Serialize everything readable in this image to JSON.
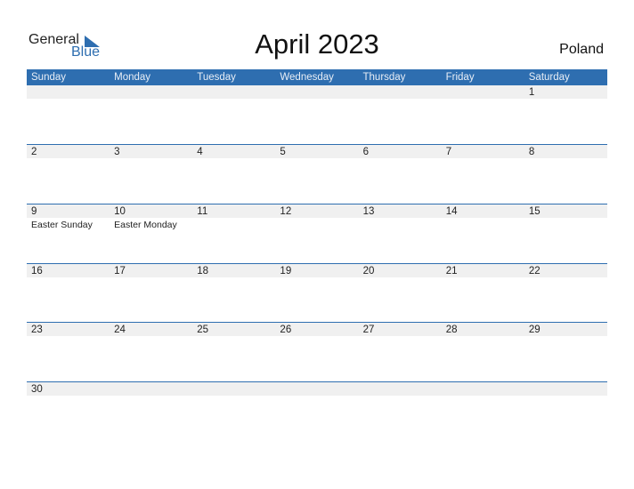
{
  "logo": {
    "word1": "General",
    "word2": "Blue"
  },
  "title": "April 2023",
  "country": "Poland",
  "colors": {
    "accent": "#2e6eb0",
    "daybar": "#f0f0f0"
  },
  "weekdays": [
    "Sunday",
    "Monday",
    "Tuesday",
    "Wednesday",
    "Thursday",
    "Friday",
    "Saturday"
  ],
  "weeks": [
    [
      {
        "d": ""
      },
      {
        "d": ""
      },
      {
        "d": ""
      },
      {
        "d": ""
      },
      {
        "d": ""
      },
      {
        "d": ""
      },
      {
        "d": "1"
      }
    ],
    [
      {
        "d": "2"
      },
      {
        "d": "3"
      },
      {
        "d": "4"
      },
      {
        "d": "5"
      },
      {
        "d": "6"
      },
      {
        "d": "7"
      },
      {
        "d": "8"
      }
    ],
    [
      {
        "d": "9",
        "e": "Easter Sunday"
      },
      {
        "d": "10",
        "e": "Easter Monday"
      },
      {
        "d": "11"
      },
      {
        "d": "12"
      },
      {
        "d": "13"
      },
      {
        "d": "14"
      },
      {
        "d": "15"
      }
    ],
    [
      {
        "d": "16"
      },
      {
        "d": "17"
      },
      {
        "d": "18"
      },
      {
        "d": "19"
      },
      {
        "d": "20"
      },
      {
        "d": "21"
      },
      {
        "d": "22"
      }
    ],
    [
      {
        "d": "23"
      },
      {
        "d": "24"
      },
      {
        "d": "25"
      },
      {
        "d": "26"
      },
      {
        "d": "27"
      },
      {
        "d": "28"
      },
      {
        "d": "29"
      }
    ],
    [
      {
        "d": "30"
      },
      {
        "d": ""
      },
      {
        "d": ""
      },
      {
        "d": ""
      },
      {
        "d": ""
      },
      {
        "d": ""
      },
      {
        "d": ""
      }
    ]
  ]
}
